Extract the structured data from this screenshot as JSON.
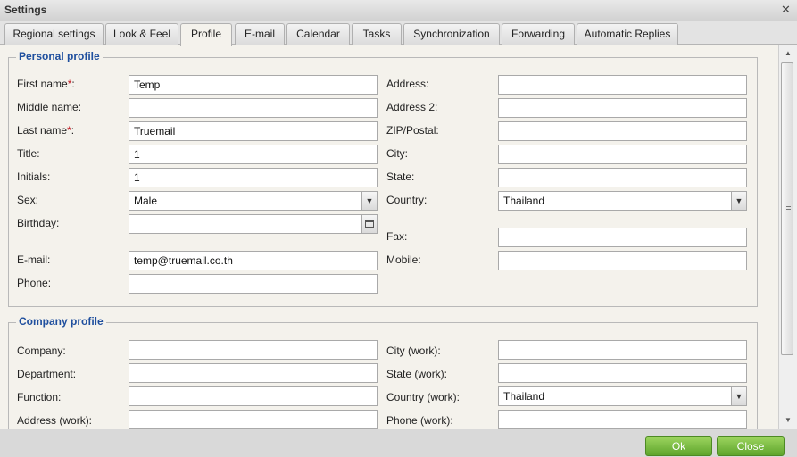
{
  "window": {
    "title": "Settings",
    "close_glyph": "✕"
  },
  "tabs": [
    {
      "label": "Regional settings",
      "active": false
    },
    {
      "label": "Look & Feel",
      "active": false
    },
    {
      "label": "Profile",
      "active": true
    },
    {
      "label": "E-mail",
      "active": false
    },
    {
      "label": "Calendar",
      "active": false
    },
    {
      "label": "Tasks",
      "active": false
    },
    {
      "label": "Synchronization",
      "active": false
    },
    {
      "label": "Forwarding",
      "active": false
    },
    {
      "label": "Automatic Replies",
      "active": false
    }
  ],
  "personal": {
    "legend": "Personal profile",
    "first_name": {
      "label": "First name",
      "required_mark": "*",
      "suffix": ":",
      "value": "Temp"
    },
    "middle_name": {
      "label": "Middle name:",
      "value": ""
    },
    "last_name": {
      "label": "Last name",
      "required_mark": "*",
      "suffix": ":",
      "value": "Truemail"
    },
    "title": {
      "label": "Title:",
      "value": "1"
    },
    "initials": {
      "label": "Initials:",
      "value": "1"
    },
    "sex": {
      "label": "Sex:",
      "value": "Male"
    },
    "birthday": {
      "label": "Birthday:",
      "value": ""
    },
    "email": {
      "label": "E-mail:",
      "value": "temp@truemail.co.th"
    },
    "phone": {
      "label": "Phone:",
      "value": ""
    },
    "address": {
      "label": "Address:",
      "value": ""
    },
    "address2": {
      "label": "Address 2:",
      "value": ""
    },
    "zip": {
      "label": "ZIP/Postal:",
      "value": ""
    },
    "city": {
      "label": "City:",
      "value": ""
    },
    "state": {
      "label": "State:",
      "value": ""
    },
    "country": {
      "label": "Country:",
      "value": "Thailand"
    },
    "fax": {
      "label": "Fax:",
      "value": ""
    },
    "mobile": {
      "label": "Mobile:",
      "value": ""
    }
  },
  "company": {
    "legend": "Company profile",
    "company": {
      "label": "Company:",
      "value": ""
    },
    "department": {
      "label": "Department:",
      "value": ""
    },
    "function": {
      "label": "Function:",
      "value": ""
    },
    "address_work": {
      "label": "Address (work):",
      "value": ""
    },
    "city_work": {
      "label": "City (work):",
      "value": ""
    },
    "state_work": {
      "label": "State (work):",
      "value": ""
    },
    "country_work": {
      "label": "Country (work):",
      "value": "Thailand"
    },
    "phone_work": {
      "label": "Phone (work):",
      "value": ""
    }
  },
  "icons": {
    "dropdown": "chevron-down-icon",
    "calendar": "calendar-icon",
    "scroll_up": "arrow-up-icon",
    "scroll_down": "arrow-down-icon"
  },
  "buttons": {
    "ok": "Ok",
    "close": "Close"
  },
  "colors": {
    "legend": "#1f4f9e",
    "required": "#c0141c",
    "button_green": "#6fb63a"
  }
}
